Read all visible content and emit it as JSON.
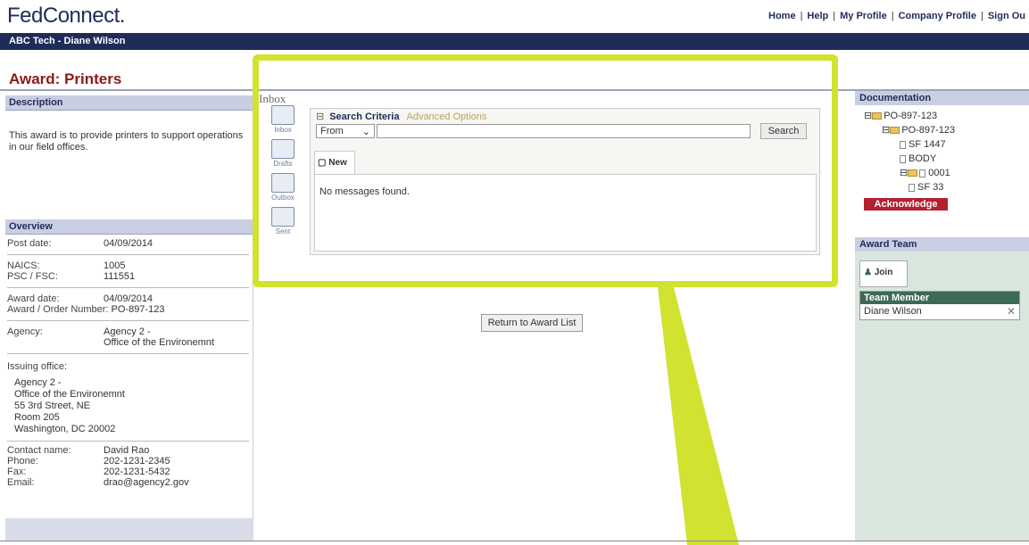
{
  "app": {
    "logo": "FedConnect."
  },
  "topnav": [
    "Home",
    "Help",
    "My Profile",
    "Company Profile",
    "Sign Ou"
  ],
  "user": {
    "label": "ABC Tech - Diane Wilson"
  },
  "page": {
    "title": "Award: Printers"
  },
  "description": {
    "header": "Description",
    "text": "This award is to provide printers to support operations in our field offices."
  },
  "overview": {
    "header": "Overview",
    "post_date_label": "Post date:",
    "post_date": "04/09/2014",
    "naics_label": "NAICS:",
    "naics": "1005",
    "psc_label": "PSC / FSC:",
    "psc": "111551",
    "award_date_label": "Award date:",
    "award_date": "04/09/2014",
    "award_number_label": "Award / Order Number:",
    "award_number": "PO-897-123",
    "agency_label": "Agency:",
    "agency_line1": "Agency 2 -",
    "agency_line2": "Office of the Environemnt",
    "issuing_label": "Issuing office:",
    "issuing_lines": [
      "Agency 2 -",
      "Office of the Environemnt",
      "55 3rd Street, NE",
      "Room 205",
      "Washington, DC 20002"
    ],
    "contact_label": "Contact name:",
    "contact": "David Rao",
    "phone_label": "Phone:",
    "phone": "202-1231-2345",
    "fax_label": "Fax:",
    "fax": "202-1231-5432",
    "email_label": "Email:",
    "email": "drao@agency2.gov"
  },
  "inbox": {
    "title": "Inbox",
    "nav": [
      "Inbox",
      "Drafts",
      "Outbox",
      "Sent"
    ],
    "search_criteria": "Search Criteria",
    "advanced_options": "Advanced Options",
    "from_option": "From",
    "search_button": "Search",
    "new_tab": "New",
    "empty_message": "No messages found."
  },
  "center": {
    "return_button": "Return to Award List"
  },
  "documentation": {
    "header": "Documentation",
    "tree": [
      "PO-897-123",
      "PO-897-123",
      "SF 1447",
      "BODY",
      "0001",
      "SF 33"
    ],
    "acknowledge": "Acknowledge"
  },
  "award_team": {
    "header": "Award Team",
    "join": "Join",
    "column": "Team Member",
    "members": [
      "Diane Wilson"
    ]
  },
  "colors": {
    "navy": "#1f2c5a",
    "title_red": "#8b1a1a",
    "highlight": "#d1e231",
    "acknowledge": "#b32030",
    "team_header": "#3d6a55"
  }
}
